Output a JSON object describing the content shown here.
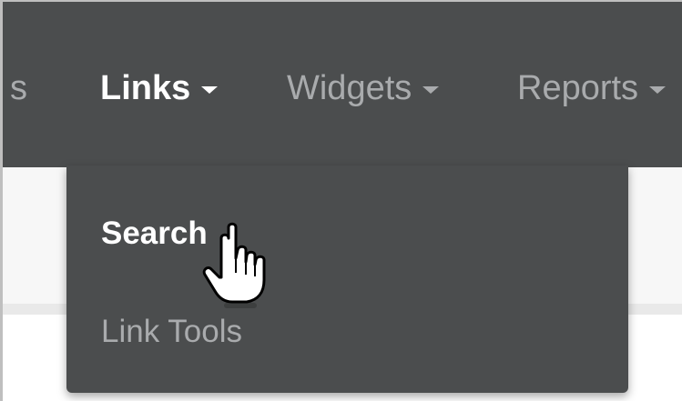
{
  "nav": {
    "partial_label": "s",
    "items": [
      {
        "label": "Links"
      },
      {
        "label": "Widgets"
      },
      {
        "label": "Reports"
      }
    ]
  },
  "dropdown": {
    "items": [
      {
        "label": "Search"
      },
      {
        "label": "Link Tools"
      }
    ]
  },
  "colors": {
    "navbar_bg": "#4b4d4e",
    "active_text": "#ffffff",
    "muted_text": "#a9abad"
  },
  "icons": {
    "caret": "caret-down-icon",
    "cursor": "hand-pointer-icon"
  }
}
